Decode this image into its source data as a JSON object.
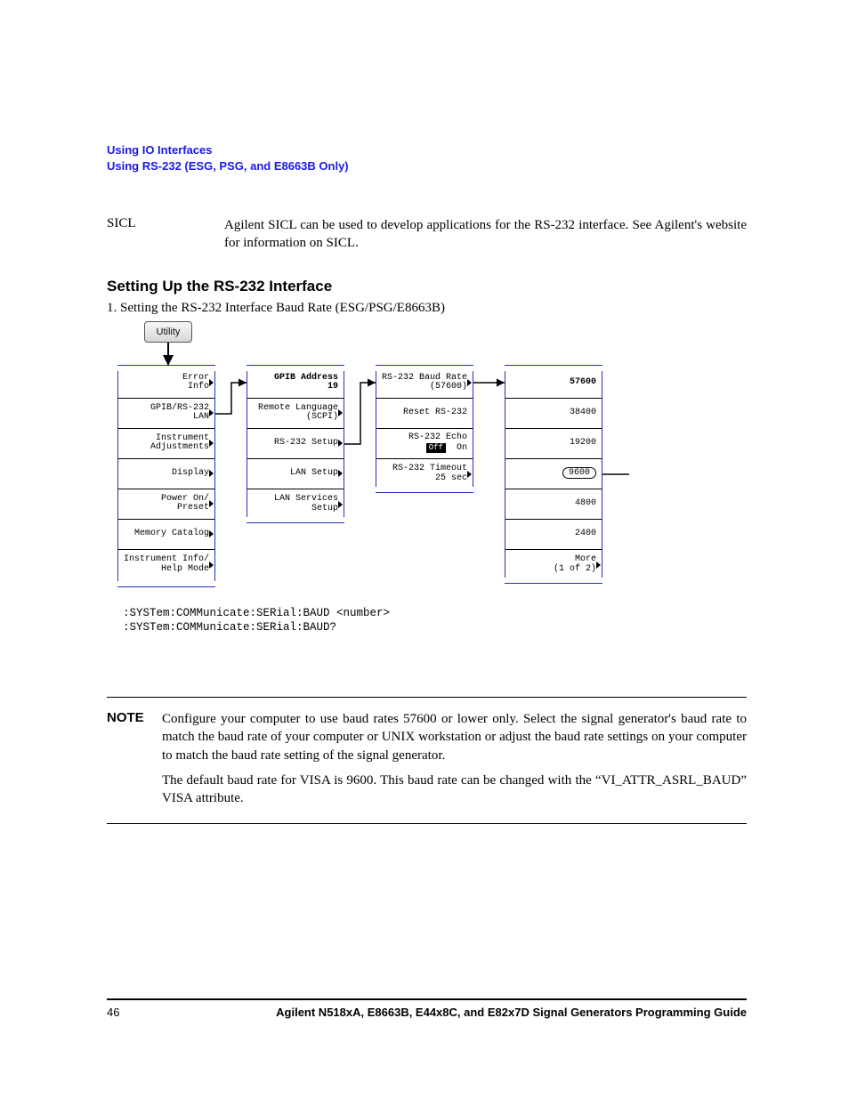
{
  "header": {
    "line1": "Using IO Interfaces",
    "line2": "Using RS-232 (ESG, PSG, and E8663B Only)"
  },
  "sicl": {
    "label": "SICL",
    "body": "Agilent SICL can be used to develop applications for the RS-232 interface. See Agilent's website for information on SICL."
  },
  "section_heading": "Setting Up the RS-232 Interface",
  "step1": "1.  Setting the RS-232 Interface Baud Rate (ESG/PSG/E8663B)",
  "diagram": {
    "utility": "Utility",
    "menu1": [
      {
        "l": "Error\nInfo",
        "arrow": true
      },
      {
        "l": "GPIB/RS-232\nLAN",
        "arrow": true
      },
      {
        "l": "Instrument\nAdjustments",
        "arrow": true
      },
      {
        "l": "Display",
        "arrow": true
      },
      {
        "l": "Power On/\nPreset",
        "arrow": true
      },
      {
        "l": "Memory Catalog",
        "arrow": true
      },
      {
        "l": "Instrument Info/\nHelp Mode",
        "arrow": true
      }
    ],
    "menu2": [
      {
        "l": "GPIB Address\n19",
        "bold": true
      },
      {
        "l": "Remote Language\n(SCPI)",
        "arrow": true
      },
      {
        "l": "RS-232 Setup",
        "arrow": true
      },
      {
        "l": "LAN Setup",
        "arrow": true
      },
      {
        "l": "LAN Services\nSetup",
        "arrow": true
      }
    ],
    "menu3": [
      {
        "l": "RS-232 Baud Rate\n(57600)",
        "arrow": true
      },
      {
        "l": "Reset RS-232"
      },
      {
        "l": "RS-232 Echo",
        "sub": "Off  On",
        "tag": "Off"
      },
      {
        "l": "RS-232 Timeout\n25 sec",
        "arrow": true
      }
    ],
    "menu4": [
      {
        "l": "57600",
        "bold": true
      },
      {
        "l": "38400"
      },
      {
        "l": "19200"
      },
      {
        "l": "9600",
        "pill": true
      },
      {
        "l": "4800"
      },
      {
        "l": "2400"
      },
      {
        "l": "More\n(1 of 2)",
        "arrow": true
      }
    ]
  },
  "scpi": {
    "line1": ":SYSTem:COMMunicate:SERial:BAUD <number>",
    "line2": ":SYSTem:COMMunicate:SERial:BAUD?"
  },
  "note": {
    "label": "NOTE",
    "p1": "Configure your computer to use baud rates 57600 or lower only. Select the signal generator's baud rate to match the baud rate of your computer or UNIX workstation or adjust the baud rate settings on your computer to match the baud rate setting of the signal generator.",
    "p2": "The default baud rate for VISA is 9600. This baud rate can be changed with the “VI_ATTR_ASRL_BAUD” VISA attribute."
  },
  "footer": {
    "page": "46",
    "title": "Agilent N518xA, E8663B, E44x8C, and E82x7D Signal Generators Programming Guide"
  }
}
